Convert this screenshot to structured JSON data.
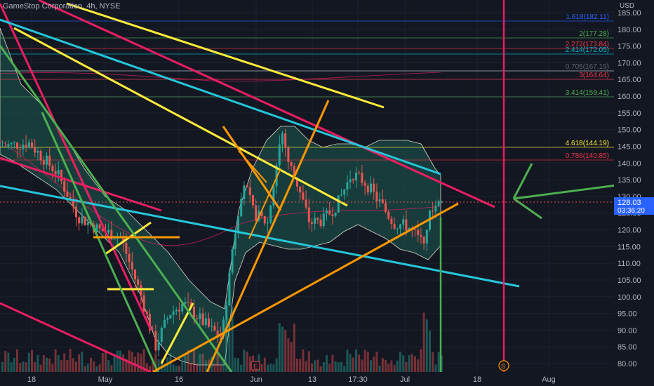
{
  "header": {
    "symbol_title": "GameStop Corporation, 4h, NYSE",
    "currency": "USD"
  },
  "price_axis": {
    "labels": [
      "185.00",
      "180.00",
      "175.00",
      "170.00",
      "165.00",
      "160.00",
      "155.00",
      "150.00",
      "145.00",
      "140.00",
      "135.00",
      "130.00",
      "125.00",
      "120.00",
      "115.00",
      "110.00",
      "105.00",
      "100.00",
      "95.00",
      "90.00",
      "85.00",
      "80.00"
    ]
  },
  "time_axis": {
    "labels": [
      "18",
      "May",
      "16",
      "Jun",
      "13",
      "17:30",
      "Jul",
      "18",
      "Aug"
    ]
  },
  "last_price": {
    "value": "128.03",
    "countdown": "03:36:20",
    "color": "#2962ff"
  },
  "fib_levels": [
    {
      "label": "1.618(182.11)",
      "color": "#2962ff"
    },
    {
      "label": "2(177.28)",
      "color": "#4caf50"
    },
    {
      "label": "2.272(173.84)",
      "color": "#f23645"
    },
    {
      "label": "2.414(172.05)",
      "color": "#00bcd4"
    },
    {
      "label": "0.705(167.19)",
      "color": "#131722"
    },
    {
      "label": "3(164.64)",
      "color": "#f23645"
    },
    {
      "label": "3.414(159.41)",
      "color": "#4caf50"
    },
    {
      "label": "4.618(144.19)",
      "color": "#ffeb3b"
    },
    {
      "label": "0.786(140.85)",
      "color": "#f23645"
    }
  ],
  "markers": {
    "earnings": "E",
    "split": "S"
  },
  "colors": {
    "up": "#26a69a",
    "down": "#ef5350",
    "bb_fill": "#1b4a44",
    "pink": "#e91e63",
    "yellow": "#ffeb3b",
    "orange": "#ff9800",
    "green": "#4caf50",
    "cyan": "#26c6da"
  }
}
